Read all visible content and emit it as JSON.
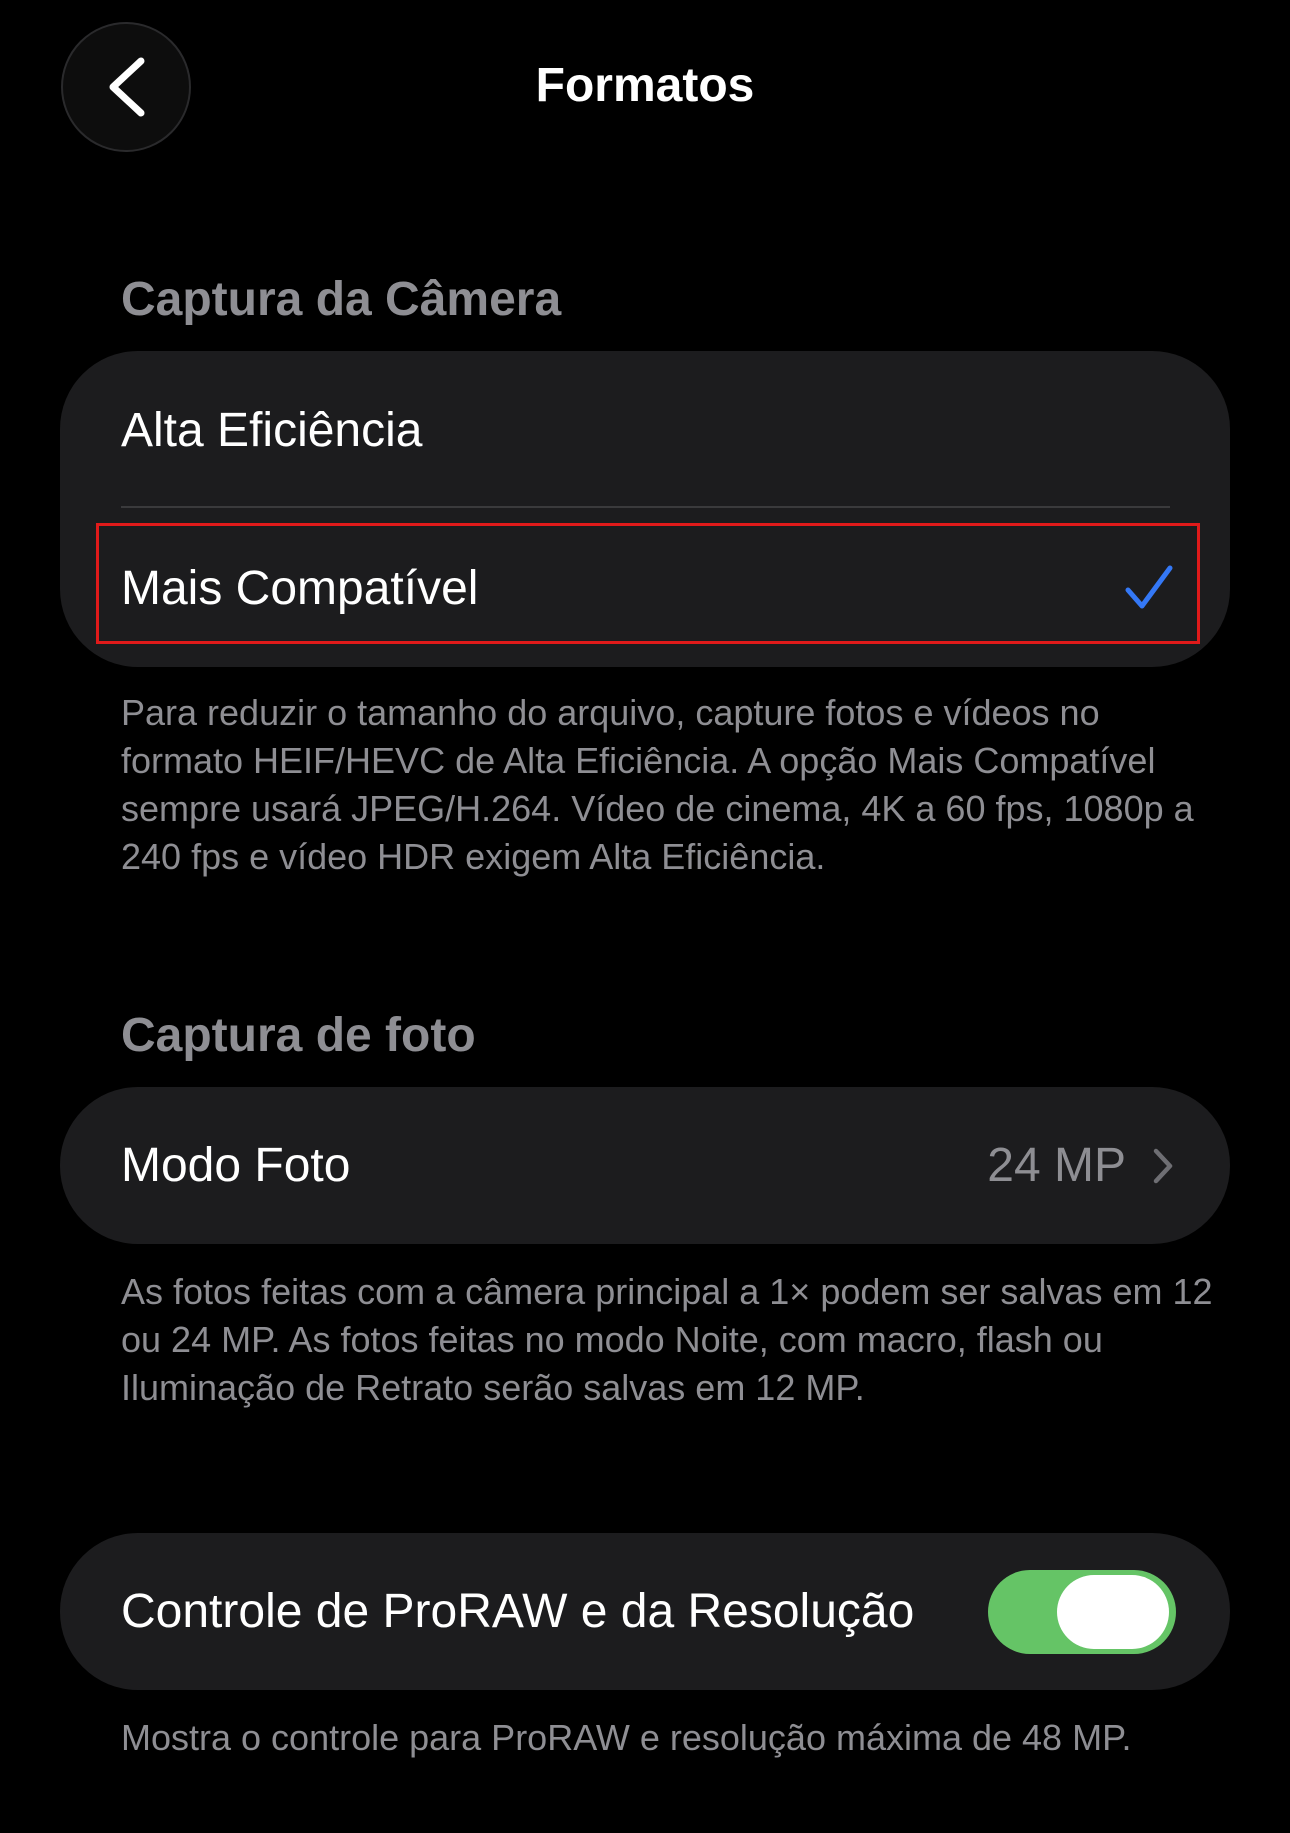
{
  "nav": {
    "title": "Formatos"
  },
  "camera_capture": {
    "header": "Captura da Câmera",
    "options": [
      {
        "label": "Alta Eficiência",
        "selected": false
      },
      {
        "label": "Mais Compatível",
        "selected": true
      }
    ],
    "footer": "Para reduzir o tamanho do arquivo, capture fotos e vídeos no formato HEIF/HEVC de Alta Eficiência. A opção Mais Compatível sempre usará JPEG/H.264. Vídeo de cinema, 4K a 60 fps, 1080p a 240 fps e vídeo HDR exigem Alta Eficiência."
  },
  "photo_capture": {
    "header": "Captura de foto",
    "photo_mode_label": "Modo Foto",
    "photo_mode_value": "24 MP",
    "footer": "As fotos feitas com a câmera principal a 1× podem ser salvas em 12 ou 24 MP. As fotos feitas no modo Noite, com macro, flash ou Iluminação de Retrato serão salvas em 12 MP."
  },
  "proraw": {
    "label": "Controle de ProRAW e da Resolução",
    "enabled": true,
    "footer": "Mostra o controle para ProRAW e resolução máxima de 48 MP."
  },
  "colors": {
    "accent": "#3478f6",
    "toggle_on": "#65c466",
    "highlight": "#e01a1a"
  }
}
